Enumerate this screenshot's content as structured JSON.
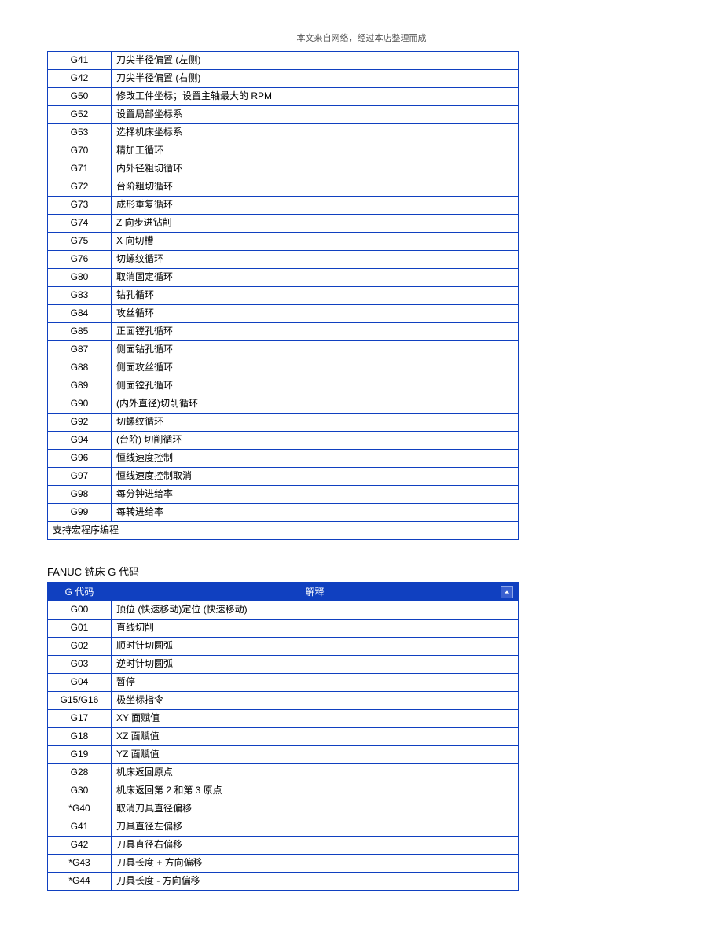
{
  "header_caption": "本文来自网络，经过本店整理而成",
  "table1": {
    "rows": [
      {
        "code": "G41",
        "desc": "刀尖半径偏置 (左侧)"
      },
      {
        "code": "G42",
        "desc": "刀尖半径偏置 (右侧)"
      },
      {
        "code": "G50",
        "desc": "修改工件坐标；设置主轴最大的 RPM"
      },
      {
        "code": "G52",
        "desc": "设置局部坐标系"
      },
      {
        "code": "G53",
        "desc": "选择机床坐标系"
      },
      {
        "code": "G70",
        "desc": "精加工循环"
      },
      {
        "code": "G71",
        "desc": "内外径粗切循环"
      },
      {
        "code": "G72",
        "desc": "台阶粗切循环"
      },
      {
        "code": "G73",
        "desc": "成形重复循环"
      },
      {
        "code": "G74",
        "desc": "Z 向步进钻削"
      },
      {
        "code": "G75",
        "desc": "X 向切槽"
      },
      {
        "code": "G76",
        "desc": "切螺纹循环"
      },
      {
        "code": "G80",
        "desc": "取消固定循环"
      },
      {
        "code": "G83",
        "desc": "钻孔循环"
      },
      {
        "code": "G84",
        "desc": "攻丝循环"
      },
      {
        "code": "G85",
        "desc": "正面镗孔循环"
      },
      {
        "code": "G87",
        "desc": "侧面钻孔循环"
      },
      {
        "code": "G88",
        "desc": "侧面攻丝循环"
      },
      {
        "code": "G89",
        "desc": "侧面镗孔循环"
      },
      {
        "code": "G90",
        "desc": "(内外直径)切削循环"
      },
      {
        "code": "G92",
        "desc": "切螺纹循环"
      },
      {
        "code": "G94",
        "desc": "(台阶) 切削循环"
      },
      {
        "code": "G96",
        "desc": "恒线速度控制"
      },
      {
        "code": "G97",
        "desc": "恒线速度控制取消"
      },
      {
        "code": "G98",
        "desc": "每分钟进给率"
      },
      {
        "code": "G99",
        "desc": "每转进给率"
      }
    ],
    "footer": "支持宏程序编程"
  },
  "section2_title": "FANUC 铣床 G 代码",
  "table2": {
    "headers": {
      "code": "G 代码",
      "desc": "解释"
    },
    "rows": [
      {
        "code": "G00",
        "desc": "顶位 (快速移动)定位 (快速移动)"
      },
      {
        "code": "G01",
        "desc": "直线切削"
      },
      {
        "code": "G02",
        "desc": "顺时针切圆弧"
      },
      {
        "code": "G03",
        "desc": "逆时针切圆弧"
      },
      {
        "code": "G04",
        "desc": "暂停"
      },
      {
        "code": "G15/G16",
        "desc": "极坐标指令"
      },
      {
        "code": "G17",
        "desc": "XY 面赋值"
      },
      {
        "code": "G18",
        "desc": "XZ 面赋值"
      },
      {
        "code": "G19",
        "desc": "YZ 面赋值"
      },
      {
        "code": "G28",
        "desc": "机床返回原点"
      },
      {
        "code": "G30",
        "desc": "机床返回第 2 和第 3 原点"
      },
      {
        "code": "*G40",
        "desc": "取消刀具直径偏移"
      },
      {
        "code": "G41",
        "desc": "刀具直径左偏移"
      },
      {
        "code": "G42",
        "desc": "刀具直径右偏移"
      },
      {
        "code": "*G43",
        "desc": "刀具长度 + 方向偏移"
      },
      {
        "code": "*G44",
        "desc": "刀具长度 - 方向偏移"
      }
    ]
  }
}
